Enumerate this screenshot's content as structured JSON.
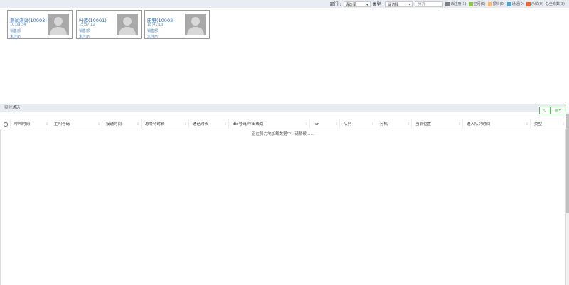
{
  "filters": {
    "dept_label": "部门 :",
    "dept_value": "请选择",
    "type_label": "类型 :",
    "type_value": "请选择",
    "ext_placeholder": "分机"
  },
  "legend": [
    {
      "label": "未注册(3)",
      "color": "#808080"
    },
    {
      "label": "空闲(0)",
      "color": "#8bc34a"
    },
    {
      "label": "振铃(0)",
      "color": "#f5b971"
    },
    {
      "label": "通话(0)",
      "color": "#4aa3df"
    },
    {
      "label": "示忙(0)",
      "color": "#f0622d"
    },
    {
      "label": "总坐席数(3)",
      "color": ""
    }
  ],
  "agents": [
    {
      "name": "测试测试(10003)",
      "time": "10:09:34",
      "dept": "销售部",
      "status": "未注册"
    },
    {
      "name": "叶添(10001)",
      "time": "15:37:12",
      "dept": "销售部",
      "status": "未注册"
    },
    {
      "name": "田野(10002)",
      "time": "18:41:13",
      "dept": "销售部",
      "status": "未注册"
    }
  ],
  "section_title": "实时通话",
  "toolbar": {
    "refresh_icon": "↻",
    "columns_icon": "▤▾"
  },
  "columns": [
    "呼叫时间",
    "主叫号码",
    "接通时间",
    "总等待时长",
    "通话时长",
    "did号码/呼出线路",
    "ivr",
    "队列",
    "分机",
    "当前位置",
    "进入队列时间",
    "类型"
  ],
  "loading_message": "正在努力地加载数据中，请稍候……"
}
